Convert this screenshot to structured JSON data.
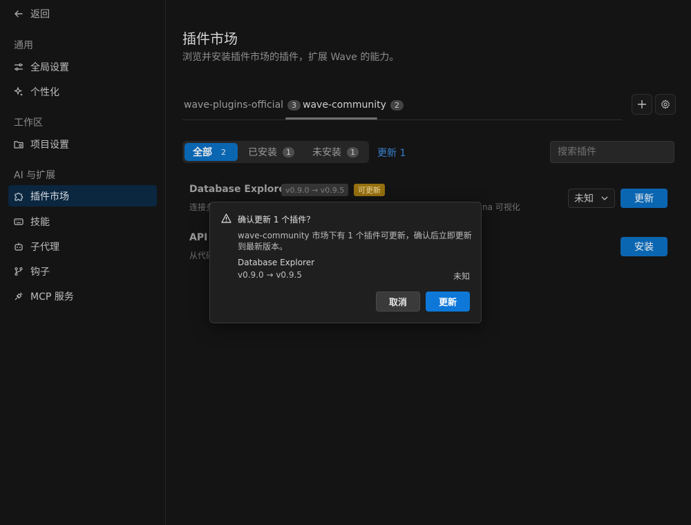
{
  "sidebar": {
    "back_label": "返回",
    "sections": [
      {
        "title": "通用"
      },
      {
        "title": "工作区"
      },
      {
        "title": "AI 与扩展"
      }
    ],
    "items": [
      {
        "label": "全局设置",
        "icon": "sliders-icon"
      },
      {
        "label": "个性化",
        "icon": "sparkle-icon"
      },
      {
        "label": "项目设置",
        "icon": "folder-gear-icon"
      },
      {
        "label": "插件市场",
        "icon": "puzzle-icon",
        "active": true
      },
      {
        "label": "技能",
        "icon": "keyboard-icon"
      },
      {
        "label": "子代理",
        "icon": "bot-icon"
      },
      {
        "label": "钩子",
        "icon": "git-branch-icon"
      },
      {
        "label": "MCP 服务",
        "icon": "plug-icon"
      }
    ]
  },
  "main": {
    "title": "插件市场",
    "subtitle": "浏览并安装插件市场的插件，扩展 Wave 的能力。",
    "tabs": [
      {
        "label": "wave-plugins-official",
        "count": "3"
      },
      {
        "label": "wave-community",
        "count": "2",
        "active": true
      }
    ],
    "filters": [
      {
        "label": "全部",
        "count": "2",
        "active": true
      },
      {
        "label": "已安装",
        "count": "1"
      },
      {
        "label": "未安装",
        "count": "1"
      }
    ],
    "update_link": "更新 1",
    "search_placeholder": "搜索插件",
    "plugins": [
      {
        "name": "Database Explorer",
        "version_tag": "v0.9.0 → v0.9.5",
        "status_tag": "可更新",
        "desc_left": "连接多",
        "desc_right": "na 可视化",
        "select_value": "未知",
        "action": "更新"
      },
      {
        "name": "API I",
        "desc_left": "从代码",
        "action": "安装"
      }
    ]
  },
  "dialog": {
    "title": "确认更新 1 个插件？",
    "body": "wave-community 市场下有 1 个插件可更新，确认后立即更新到最新版本。",
    "plugin_name": "Database Explorer",
    "plugin_version": "v0.9.0 → v0.9.5",
    "plugin_status": "未知",
    "cancel_label": "取消",
    "confirm_label": "更新"
  },
  "colors": {
    "accent": "#0d6fc2",
    "warning_tag": "#a37a12",
    "background": "#161616"
  }
}
